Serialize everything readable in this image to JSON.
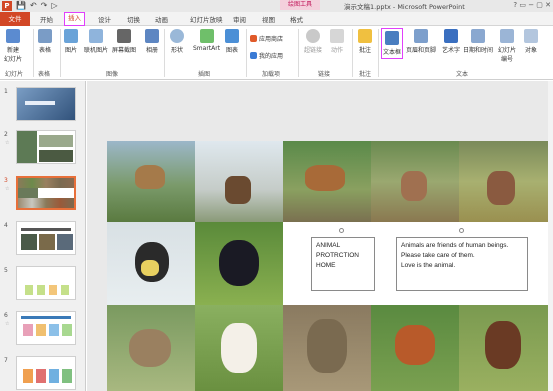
{
  "app": {
    "document_title": "演示文稿1.pptx - Microsoft PowerPoint",
    "context_tab_group": "绘图工具",
    "logo_letter": "P",
    "window_controls": "? ▭ − ▢ ✕"
  },
  "qat": {
    "save": "💾",
    "undo": "↶",
    "redo": "↷",
    "start": "▷"
  },
  "tabs": [
    "文件",
    "开始",
    "插入",
    "设计",
    "切换",
    "动画",
    "幻灯片放映",
    "审阅",
    "视图",
    "格式"
  ],
  "ribbon": {
    "buttons": [
      "新建\n幻灯片",
      "表格",
      "图片",
      "联机图片",
      "屏幕截图",
      "相册",
      "形状",
      "SmartArt",
      "图表",
      "应用商店",
      "我的应用",
      "超链接",
      "动作",
      "批注",
      "文本框",
      "页眉和页脚",
      "艺术字",
      "日期和时间",
      "幻灯片\n编号",
      "对象"
    ],
    "groups": [
      "幻灯片",
      "表格",
      "图像",
      "插图",
      "加载项",
      "链接",
      "批注",
      "文本"
    ]
  },
  "thumbnails": [
    {
      "num": "1",
      "star": ""
    },
    {
      "num": "2",
      "star": "☆"
    },
    {
      "num": "3",
      "star": "☆"
    },
    {
      "num": "4",
      "star": ""
    },
    {
      "num": "5",
      "star": ""
    },
    {
      "num": "6",
      "star": "☆"
    },
    {
      "num": "7",
      "star": ""
    }
  ],
  "slide": {
    "box1": [
      "ANIMAL",
      "PROTRCTION",
      "HOME"
    ],
    "box2": [
      "Animals are friends of human beings.",
      "Please take care of them.",
      "Love is the animal."
    ],
    "photos": [
      "deer",
      "stag",
      "goat",
      "deer-doe",
      "antelope",
      "magpie",
      "black-bird",
      "rabbit",
      "puppy",
      "monkey",
      "red-panda",
      "squirrel"
    ]
  },
  "colors": {
    "accent": "#d24726",
    "highlight": "#e040fb",
    "active_thumb": "#e8703a"
  }
}
